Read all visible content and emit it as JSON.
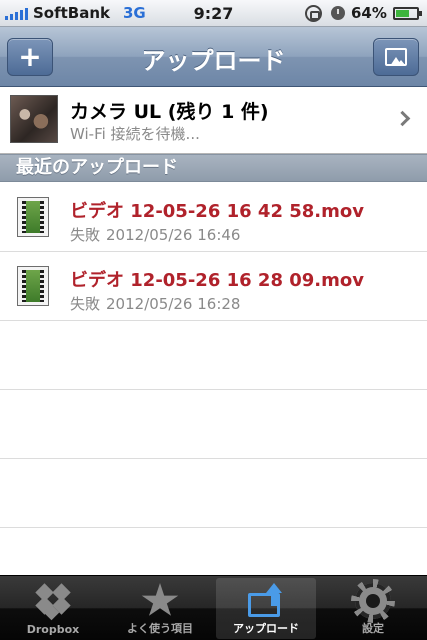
{
  "status_bar": {
    "carrier": "SoftBank",
    "network": "3G",
    "time": "9:27",
    "battery": "64%",
    "battery_level": 0.64
  },
  "nav": {
    "title": "アップロード",
    "add_label": "+"
  },
  "camera_upload": {
    "title": "カメラ UL (残り 1 件)",
    "subtitle": "Wi-Fi 接続を待機..."
  },
  "section": {
    "title": "最近のアップロード"
  },
  "uploads": [
    {
      "name": "ビデオ 12-05-26 16 42 58.mov",
      "status": "失敗",
      "date": "2012/05/26 16:46"
    },
    {
      "name": "ビデオ 12-05-26 16 28 09.mov",
      "status": "失敗",
      "date": "2012/05/26 16:28"
    }
  ],
  "tabs": [
    {
      "label": "Dropbox",
      "icon": "dropbox-icon"
    },
    {
      "label": "よく使う項目",
      "icon": "star-icon"
    },
    {
      "label": "アップロード",
      "icon": "upload-icon",
      "active": true
    },
    {
      "label": "設定",
      "icon": "gear-icon"
    }
  ],
  "colors": {
    "accent_blue": "#2a6fd6",
    "failed_red": "#b0222b",
    "nav_blue": "#6d86a7"
  }
}
